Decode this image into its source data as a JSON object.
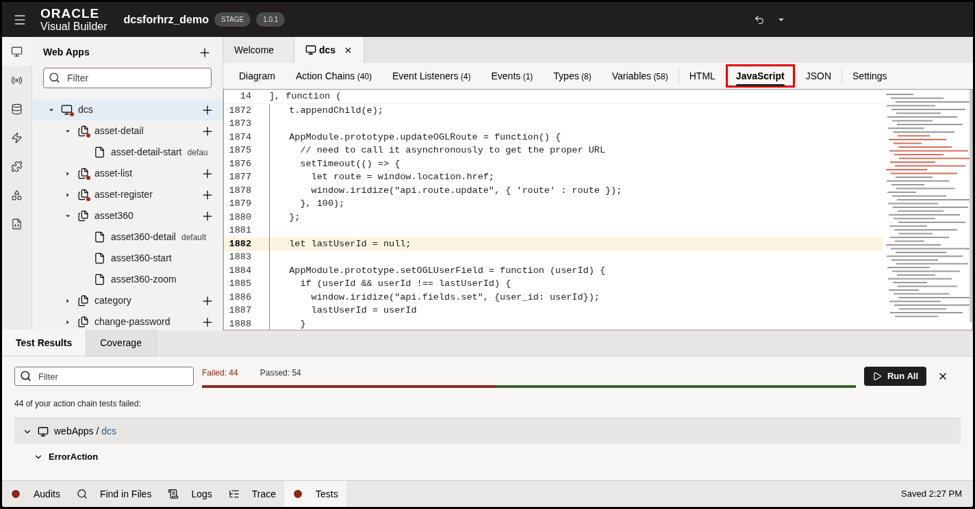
{
  "header": {
    "logo_top": "ORACLE",
    "logo_bottom": "Visual Builder",
    "app_name": "dcsforhrz_demo",
    "badges": [
      "STAGE",
      "1.0.1"
    ]
  },
  "rail": [
    {
      "kind": "monitor",
      "selected": true
    },
    {
      "kind": "service",
      "selected": false
    },
    {
      "kind": "database",
      "selected": false
    },
    {
      "kind": "bolt",
      "selected": false
    },
    {
      "kind": "puzzle",
      "selected": false
    },
    {
      "kind": "shapes",
      "selected": false
    },
    {
      "kind": "code",
      "selected": false
    }
  ],
  "navigator": {
    "title": "Web Apps",
    "filter": {
      "placeholder": "Filter"
    },
    "tree": [
      {
        "label": "dcs",
        "kind": "app",
        "expanded": true,
        "error": true,
        "selected": true,
        "children": [
          {
            "label": "asset-detail",
            "kind": "flow",
            "expanded": true,
            "error": true,
            "selected": false,
            "children": [
              {
                "label": "asset-detail-start",
                "kind": "page",
                "suffix": "defau",
                "selected": false
              }
            ]
          },
          {
            "label": "asset-list",
            "kind": "flow",
            "expanded": false,
            "error": true,
            "selected": false
          },
          {
            "label": "asset-register",
            "kind": "flow",
            "expanded": false,
            "error": true,
            "selected": false
          },
          {
            "label": "asset360",
            "kind": "flow",
            "expanded": true,
            "error": false,
            "selected": false,
            "children": [
              {
                "label": "asset360-detail",
                "kind": "page",
                "suffix": "default",
                "selected": false
              },
              {
                "label": "asset360-start",
                "kind": "page",
                "selected": false
              },
              {
                "label": "asset360-zoom",
                "kind": "page",
                "selected": false
              }
            ]
          },
          {
            "label": "category",
            "kind": "flow",
            "expanded": false,
            "error": false,
            "selected": false
          },
          {
            "label": "change-password",
            "kind": "flow",
            "expanded": false,
            "error": false,
            "selected": false
          }
        ]
      }
    ]
  },
  "editor_tabs": [
    {
      "label": "Welcome",
      "selected": false,
      "kind": "plain"
    },
    {
      "label": "dcs",
      "selected": true,
      "kind": "app"
    }
  ],
  "sub_tabs": [
    {
      "label": "Diagram",
      "selected": false,
      "highlighted": false
    },
    {
      "label": "Action Chains",
      "count": "(40)",
      "selected": false,
      "highlighted": false
    },
    {
      "label": "Event Listeners",
      "count": "(4)",
      "selected": false,
      "highlighted": false
    },
    {
      "label": "Events",
      "count": "(1)",
      "selected": false,
      "highlighted": false
    },
    {
      "label": "Types",
      "count": "(8)",
      "selected": false,
      "highlighted": false
    },
    {
      "label": "Variables",
      "count": "(58)",
      "selected": false,
      "highlighted": false
    },
    {
      "label": "HTML",
      "selected": false,
      "highlighted": false
    },
    {
      "label": "JavaScript",
      "selected": true,
      "highlighted": true
    },
    {
      "label": "JSON",
      "selected": false,
      "highlighted": false
    },
    {
      "label": "Settings",
      "selected": false,
      "highlighted": false
    }
  ],
  "code": {
    "sticky": {
      "number": "14",
      "text": "], function ("
    },
    "lines": [
      {
        "number": "1872",
        "text": "  t.appendChild(e);",
        "highlighted": false
      },
      {
        "number": "1873",
        "highlighted": false
      },
      {
        "number": "1874",
        "text": "  AppModule.prototype.updateOGLRoute = function() {",
        "highlighted": false
      },
      {
        "number": "1875",
        "text": "    // need to call it asynchronously to get the proper URL",
        "highlighted": false
      },
      {
        "number": "1876",
        "text": "    setTimeout(() => {",
        "highlighted": false
      },
      {
        "number": "1877",
        "text": "      let route = window.location.href;",
        "highlighted": false
      },
      {
        "number": "1878",
        "text": "      window.iridize(\"api.route.update\", { 'route' : route });",
        "highlighted": false
      },
      {
        "number": "1879",
        "text": "    }, 100);",
        "highlighted": false
      },
      {
        "number": "1880",
        "text": "  };",
        "highlighted": false
      },
      {
        "number": "1881",
        "highlighted": false
      },
      {
        "number": "1882",
        "text": "  let lastUserId = null;",
        "highlighted": true
      },
      {
        "number": "1883",
        "highlighted": false
      },
      {
        "number": "1884",
        "text": "  AppModule.prototype.setOGLUserField = function (userId) {",
        "highlighted": false
      },
      {
        "number": "1885",
        "text": "    if (userId && userId !== lastUserId) {",
        "highlighted": false
      },
      {
        "number": "1886",
        "text": "      window.iridize(\"api.fields.set\", {user_id: userId});",
        "highlighted": false
      },
      {
        "number": "1887",
        "text": "      lastUserId = userId",
        "highlighted": false
      },
      {
        "number": "1888",
        "text": "    }",
        "highlighted": false
      }
    ]
  },
  "bottom_tabs": [
    {
      "label": "Test Results",
      "selected": true
    },
    {
      "label": "Coverage",
      "selected": false
    }
  ],
  "tests": {
    "filter": {
      "placeholder": "Filter"
    },
    "failed": "Failed: 44",
    "passed": "Passed: 54",
    "level": 0.449,
    "run_button": "Run All",
    "summary": "44 of your action chain tests failed:",
    "group": {
      "prefix": "webApps /",
      "link": "dcs",
      "expanded": true
    },
    "action": {
      "label": "ErrorAction",
      "expanded": true
    }
  },
  "status_bar": {
    "tabs": [
      {
        "label": "Audits",
        "kind": "error",
        "selected": false
      },
      {
        "label": "Find in Files",
        "kind": "search",
        "selected": false
      },
      {
        "label": "Logs",
        "kind": "logs",
        "selected": false
      },
      {
        "label": "Trace",
        "kind": "trace",
        "selected": false
      },
      {
        "label": "Tests",
        "kind": "error",
        "selected": true
      }
    ],
    "saved": "Saved 2:27 PM"
  }
}
